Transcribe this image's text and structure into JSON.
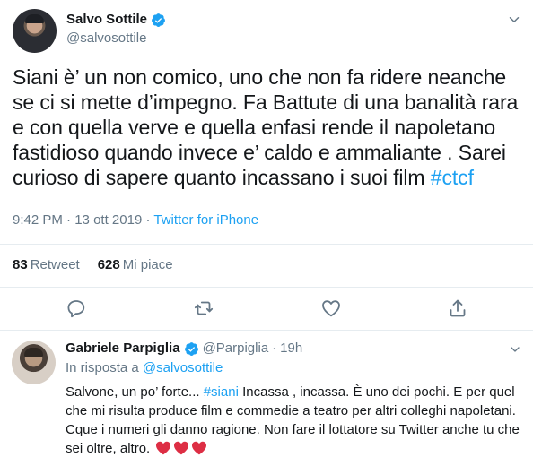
{
  "tweet": {
    "author_name": "Salvo Sottile",
    "author_handle": "@salvosottile",
    "text_main": "Siani è’ un non comico, uno che non fa ridere neanche se ci si mette d’impegno. Fa Battute di una banalità rara e con quella verve e quella enfasi rende il napoletano fastidioso quando invece e’ caldo e ammaliante . Sarei curioso di sapere quanto incassano i suoi film ",
    "hashtag": "#ctcf",
    "time": "9:42 PM",
    "date_separator": " · ",
    "date": "13 ott 2019",
    "source_separator": " · ",
    "source": "Twitter for iPhone",
    "retweets_count": "83",
    "retweets_label": "Retweet",
    "likes_count": "628",
    "likes_label": "Mi piace"
  },
  "reply": {
    "author_name": "Gabriele Parpiglia",
    "author_handle": "@Parpiglia",
    "dot": "·",
    "time": "19h",
    "reply_to_prefix": "In risposta a ",
    "reply_to_handle": "@salvosottile",
    "text_part1": "Salvone, un po’ forte... ",
    "hashtag": "#siani",
    "text_part2": " Incassa , incassa. È uno dei pochi. E per quel che mi risulta  produce film e commedie a teatro per altri colleghi napoletani. Cque i numeri gli danno ragione. Non fare il lottatore su Twitter anche tu che sei oltre, altro. ",
    "emoji": [
      "red-heart",
      "red-heart",
      "red-heart"
    ]
  },
  "colors": {
    "accent": "#1da1f2",
    "text": "#14171a",
    "muted": "#657786",
    "divider": "#e6ecf0",
    "heart": "#e0245e"
  },
  "icons": {
    "reply": "reply-icon",
    "retweet": "retweet-icon",
    "like": "like-icon",
    "share": "share-icon",
    "more": "chevron-down-icon",
    "verified": "verified-icon"
  }
}
